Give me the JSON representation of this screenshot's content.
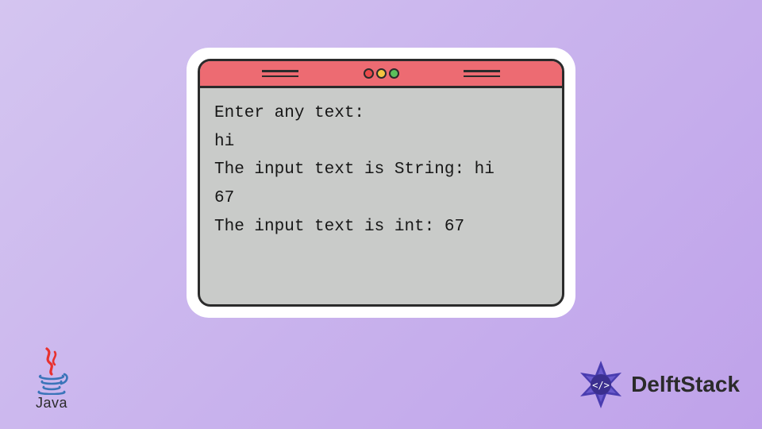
{
  "terminal": {
    "lines": [
      "Enter any text:",
      "hi",
      "The input text is String: hi",
      "67",
      "The input text is int: 67"
    ]
  },
  "logos": {
    "java_label": "Java",
    "delft_label": "DelftStack"
  },
  "colors": {
    "titlebar": "#ed6b72",
    "body": "#c9cbc9",
    "border": "#2b2b2b"
  }
}
